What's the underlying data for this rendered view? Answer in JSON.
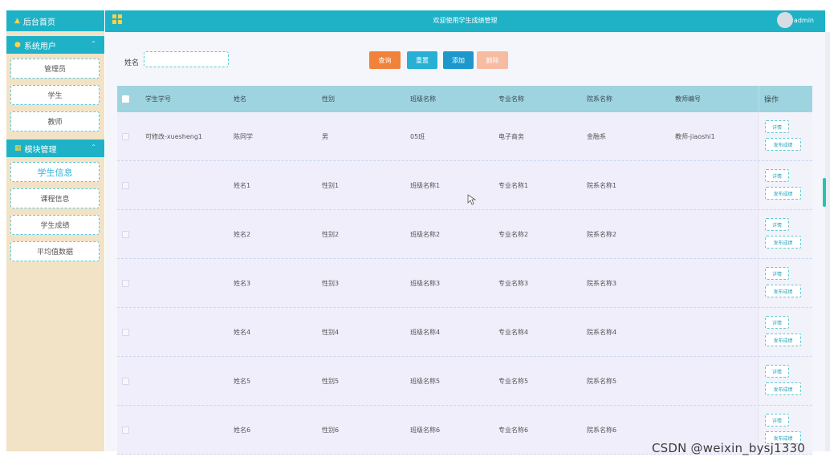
{
  "sidebar": {
    "home_label": "后台首页",
    "groups": [
      {
        "label": "系统用户",
        "items": [
          "管理员",
          "学生",
          "教师"
        ]
      },
      {
        "label": "模块管理",
        "items": [
          "学生信息",
          "课程信息",
          "学生成绩",
          "平均值数据"
        ]
      }
    ],
    "active_item": "学生信息"
  },
  "header": {
    "title": "欢迎使用学生成绩管理",
    "user": "admin"
  },
  "search": {
    "label": "姓名",
    "value": "",
    "placeholder": ""
  },
  "toolbar": {
    "query_label": "查询",
    "reset_label": "重置",
    "add_label": "添加",
    "delete_label": "删除"
  },
  "table": {
    "columns": [
      "学生学号",
      "姓名",
      "性别",
      "班级名称",
      "专业名称",
      "院系名称",
      "教师编号",
      "操作"
    ],
    "rows": [
      [
        "可修改-xuesheng1",
        "陈同学",
        "男",
        "05班",
        "电子商务",
        "金融系",
        "教师-jiaoshi1"
      ],
      [
        "",
        "姓名1",
        "性别1",
        "班级名称1",
        "专业名称1",
        "院系名称1",
        ""
      ],
      [
        "",
        "姓名2",
        "性别2",
        "班级名称2",
        "专业名称2",
        "院系名称2",
        ""
      ],
      [
        "",
        "姓名3",
        "性别3",
        "班级名称3",
        "专业名称3",
        "院系名称3",
        ""
      ],
      [
        "",
        "姓名4",
        "性别4",
        "班级名称4",
        "专业名称4",
        "院系名称4",
        ""
      ],
      [
        "",
        "姓名5",
        "性别5",
        "班级名称5",
        "专业名称5",
        "院系名称5",
        ""
      ],
      [
        "",
        "姓名6",
        "性别6",
        "班级名称6",
        "专业名称6",
        "院系名称6",
        ""
      ]
    ],
    "row_actions": {
      "detail_label": "详情",
      "publish_label": "发布成绩"
    }
  },
  "watermark": "CSDN @weixin_bysj1330",
  "colors": {
    "accent": "#1fb2c6",
    "sidebar_bg": "#f2e2c6",
    "query": "#f1823a",
    "reset": "#27b0d3",
    "add": "#1d98cc",
    "delete": "#f6bba0",
    "table_header": "#9ed4df"
  },
  "icons": {
    "home": "home-icon",
    "user": "user-icon",
    "module": "grid-icon",
    "menu": "grid-menu-icon",
    "avatar": "avatar-icon"
  }
}
